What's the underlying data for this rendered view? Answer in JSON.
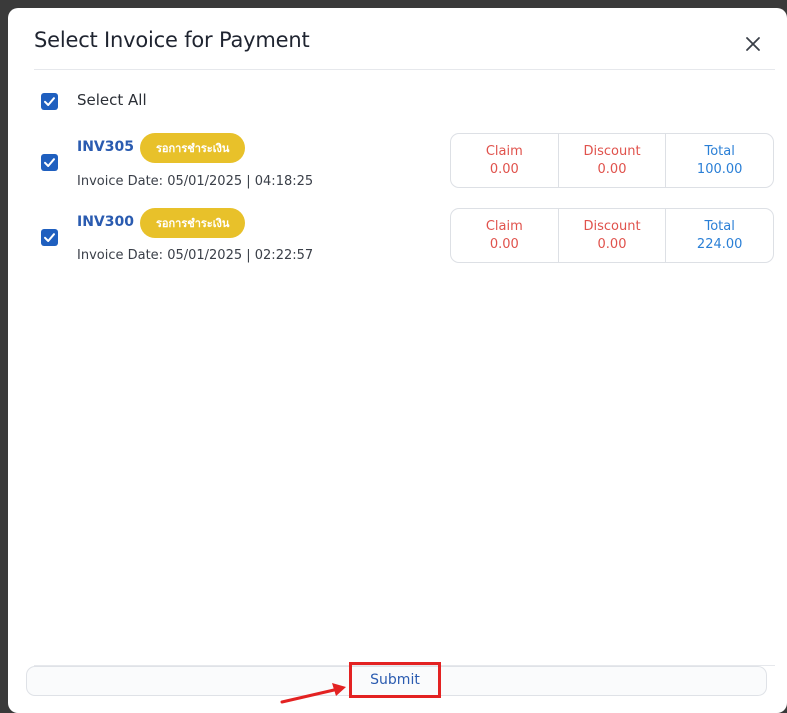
{
  "modal": {
    "title": "Select Invoice for Payment"
  },
  "select_all": {
    "label": "Select All",
    "checked": true
  },
  "invoices": [
    {
      "number": "INV305",
      "status": "รอการชำระเงิน",
      "date": "Invoice Date: 05/01/2025 | 04:18:25",
      "checked": true,
      "claim_label": "Claim",
      "claim": "0.00",
      "discount_label": "Discount",
      "discount": "0.00",
      "total_label": "Total",
      "total": "100.00"
    },
    {
      "number": "INV300",
      "status": "รอการชำระเงิน",
      "date": "Invoice Date: 05/01/2025 | 02:22:57",
      "checked": true,
      "claim_label": "Claim",
      "claim": "0.00",
      "discount_label": "Discount",
      "discount": "0.00",
      "total_label": "Total",
      "total": "224.00"
    }
  ],
  "footer": {
    "submit_label": "Submit"
  },
  "colors": {
    "checkbox": "#1f5fbf",
    "badge": "#e8c12a",
    "claim_discount_text": "#e0524c",
    "total_text": "#2a7fd6",
    "invoice_number": "#2a5bb0",
    "highlight_box": "#e32222"
  },
  "icons": {
    "close": "close-icon",
    "checkbox": "checkmark-icon",
    "annotation": "red-arrow-icon"
  }
}
